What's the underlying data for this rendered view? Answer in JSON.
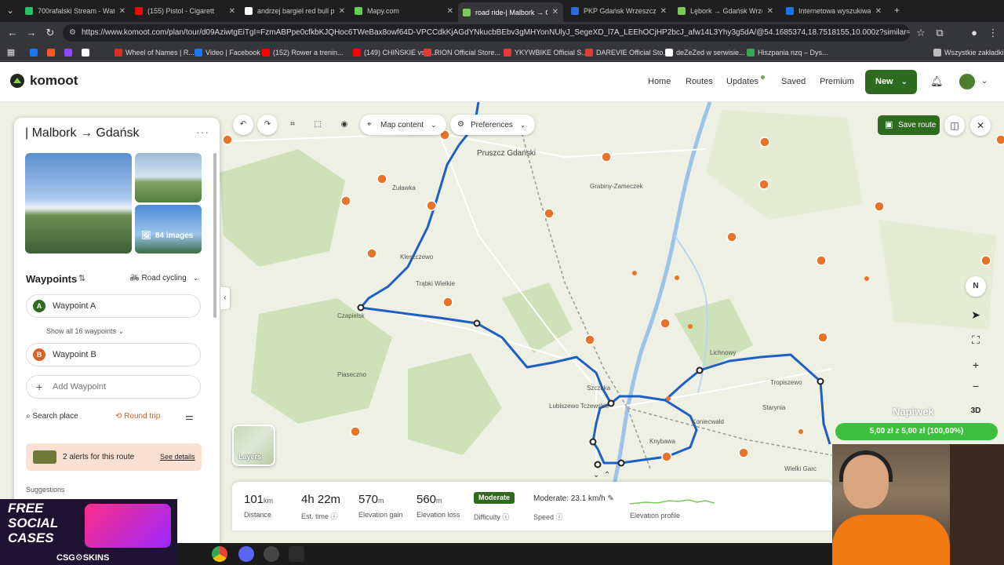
{
  "browser": {
    "tabs": [
      {
        "title": "700rafalski Stream - Watc",
        "color": "#23c26b"
      },
      {
        "title": "(155) Pistol - Cigarett",
        "color": "#ff0000"
      },
      {
        "title": "andrzej bargiel red bull p",
        "color": "#ffffff"
      },
      {
        "title": "Mapy.com",
        "color": "#5fd14f"
      },
      {
        "title": "road ride-| Malbork → Gd",
        "color": "#7cc85a",
        "active": true
      },
      {
        "title": "PKP Gdańsk Wrzeszcz > M",
        "color": "#2b6bd6"
      },
      {
        "title": "Lębork → Gdańsk Wrzesz",
        "color": "#7cc85a"
      },
      {
        "title": "Internetowa wyszukiwark",
        "color": "#1a73e8"
      }
    ],
    "url": "https://www.komoot.com/plan/tour/d09AziwtgEiTgI=FzmABPpe0cfkbKJQHoc6TWeBax8owf64D-VPCCdkKjAGdYNkucbBEbv3gMHYonNUlyJ_SegeXD_l7A_LEEhOCjHP2bcJ_afw14L3Yhy3g5dA/@54.1685374,18.7518155,10.000z?similar=2...",
    "bookmarks": [
      {
        "label": "",
        "color": "#1877f2"
      },
      {
        "label": "",
        "color": "#ff5722"
      },
      {
        "label": "",
        "color": "#9146ff"
      },
      {
        "label": "",
        "color": "#ffffff"
      },
      {
        "label": "Wheel of Names | R...",
        "color": "#d93025"
      },
      {
        "label": "Video | Facebook",
        "color": "#1877f2"
      },
      {
        "label": "(152) Rower a trenin...",
        "color": "#ff0000"
      },
      {
        "label": "(149) CHIŃSKIE vs E...",
        "color": "#ff0000"
      },
      {
        "label": "RION Official Store...",
        "color": "#e53935"
      },
      {
        "label": "YKYWBIKE Official S...",
        "color": "#e53935"
      },
      {
        "label": "DAREVIE Official Sto...",
        "color": "#e53935"
      },
      {
        "label": "deZeZed w serwisie...",
        "color": "#ffffff"
      },
      {
        "label": "Hiszpania nzq – Dys...",
        "color": "#34a853"
      }
    ],
    "bookmarks_folder": "Wszystkie zakładki"
  },
  "komoot": {
    "logo": "komoot",
    "nav": [
      "Home",
      "Routes",
      "Updates",
      "Saved",
      "Premium"
    ],
    "new_label": "New"
  },
  "panel": {
    "title": "| Malbork → Gdańsk",
    "images_count": "84 images",
    "waypoints_label": "Waypoints",
    "sport": "Road cycling",
    "waypoint_a": "Waypoint A",
    "show_all": "Show all 16 waypoints",
    "waypoint_b": "Waypoint B",
    "add_waypoint": "Add Waypoint",
    "search_place": "Search place",
    "round_trip": "Round trip",
    "alerts_text": "2 alerts for this route",
    "alerts_link": "See details",
    "suggestions": "Suggestions"
  },
  "map_controls": {
    "map_content": "Map content",
    "preferences": "Preferences",
    "save_route": "Save route",
    "layers": "Layers",
    "three_d": "3D",
    "north": "N"
  },
  "stats": {
    "distance": {
      "value": "101",
      "unit": "km",
      "label": "Distance"
    },
    "time": {
      "value": "4h 22m",
      "label": "Est. time"
    },
    "gain": {
      "value": "570",
      "unit": "m",
      "label": "Elevation gain"
    },
    "loss": {
      "value": "560",
      "unit": "m",
      "label": "Elevation loss"
    },
    "difficulty": {
      "value": "Moderate",
      "label": "Difficulty"
    },
    "speed": {
      "value": "Moderate: 23.1 km/h",
      "label": "Speed"
    },
    "profile": {
      "label": "Elevation profile"
    }
  },
  "overlay": {
    "donation": "5,00 zł z 5,00 zł (100,00%)",
    "napiwek": "Napiwek",
    "ad_line1": "FREE",
    "ad_line2": "SOCIAL",
    "ad_line3": "CASES",
    "ad_brand": "CSG⚙SKINS"
  },
  "map_places": [
    "Pruszcz Gdański",
    "Żuławka",
    "Kleszczewo",
    "Trąbki Wielkie",
    "Lubiszewo Tczewskie",
    "Szczuka",
    "Czapielsk",
    "Grabiny-Zameczek",
    "Lichnowy",
    "Tropiszewo",
    "Starynia",
    "Koniecwałd",
    "Knybawa",
    "Wielki Garc",
    "Piaseczno"
  ]
}
